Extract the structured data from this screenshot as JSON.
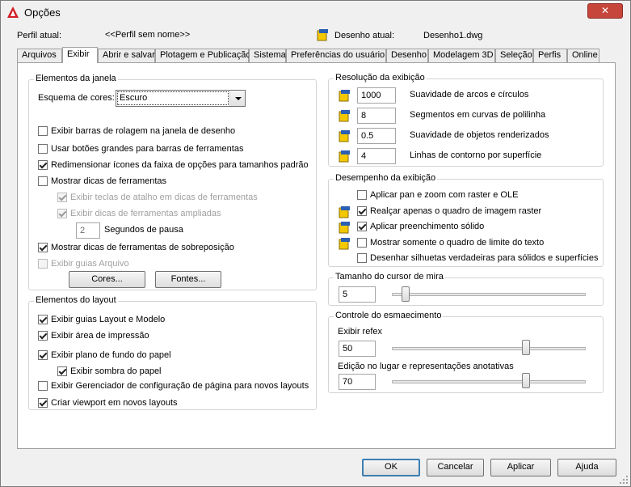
{
  "window": {
    "title": "Opções",
    "close_label": "✕"
  },
  "profile": {
    "current_profile_label": "Perfil atual:",
    "current_profile_value": "<<Perfil sem nome>>",
    "current_drawing_label": "Desenho atual:",
    "current_drawing_value": "Desenho1.dwg"
  },
  "tabs": [
    "Arquivos",
    "Exibir",
    "Abrir e salvar",
    "Plotagem e Publicação",
    "Sistema",
    "Preferências do usuário",
    "Desenho",
    "Modelagem 3D",
    "Seleção",
    "Perfis",
    "Online"
  ],
  "active_tab": "Exibir",
  "window_elements": {
    "title": "Elementos da janela",
    "color_scheme_label": "Esquema de cores:",
    "color_scheme_value": "Escuro",
    "options": [
      {
        "label": "Exibir barras de rolagem na janela de desenho",
        "checked": false,
        "enabled": true
      },
      {
        "label": "Usar botões grandes para barras de ferramentas",
        "checked": false,
        "enabled": true
      },
      {
        "label": "Redimensionar ícones da faixa de opções para tamanhos padrão",
        "checked": true,
        "enabled": true
      },
      {
        "label": "Mostrar dicas de ferramentas",
        "checked": false,
        "enabled": true
      },
      {
        "label": "Exibir teclas de atalho em dicas de ferramentas",
        "checked": true,
        "enabled": false
      },
      {
        "label": "Exibir dicas de ferramentas ampliadas",
        "checked": true,
        "enabled": false
      },
      {
        "label": "Mostrar dicas de ferramentas de sobreposição",
        "checked": true,
        "enabled": true
      },
      {
        "label": "Exibir guias Arquivo",
        "checked": false,
        "enabled": false
      }
    ],
    "delay_value": "2",
    "delay_label": "Segundos de pausa",
    "colors_button": "Cores...",
    "fonts_button": "Fontes..."
  },
  "layout_elements": {
    "title": "Elementos do layout",
    "options": [
      {
        "label": "Exibir guias Layout e Modelo",
        "checked": true
      },
      {
        "label": "Exibir área de impressão",
        "checked": true
      },
      {
        "label": "Exibir plano de fundo do papel",
        "checked": true
      },
      {
        "label": "Exibir sombra do papel",
        "checked": true
      },
      {
        "label": "Exibir Gerenciador de configuração de página para novos layouts",
        "checked": false
      },
      {
        "label": "Criar viewport em novos layouts",
        "checked": true
      }
    ]
  },
  "resolution": {
    "title": "Resolução da exibição",
    "rows": [
      {
        "value": "1000",
        "label": "Suavidade de arcos e círculos"
      },
      {
        "value": "8",
        "label": "Segmentos em curvas de polilinha"
      },
      {
        "value": "0.5",
        "label": "Suavidade de objetos renderizados"
      },
      {
        "value": "4",
        "label": "Linhas de contorno por superfície"
      }
    ]
  },
  "performance": {
    "title": "Desempenho da exibição",
    "options": [
      {
        "label": "Aplicar pan e zoom com raster e OLE",
        "checked": false,
        "icon": false
      },
      {
        "label": "Realçar apenas o quadro de imagem raster",
        "checked": true,
        "icon": true
      },
      {
        "label": "Aplicar preenchimento sólido",
        "checked": true,
        "icon": true
      },
      {
        "label": "Mostrar somente o quadro de limite do texto",
        "checked": false,
        "icon": true
      },
      {
        "label": "Desenhar silhuetas verdadeiras para sólidos e superfícies",
        "checked": false,
        "icon": false
      }
    ]
  },
  "crosshair": {
    "title": "Tamanho do cursor de mira",
    "value": "5",
    "level_fraction": 0.05
  },
  "fade": {
    "title": "Controle do esmaecimento",
    "xref_label": "Exibir refex",
    "xref_value": "50",
    "xref_fraction": 0.7,
    "inplace_label": "Edição no lugar e representações anotativas",
    "inplace_value": "70",
    "inplace_fraction": 0.7
  },
  "footer": {
    "ok": "OK",
    "cancel": "Cancelar",
    "apply": "Aplicar",
    "help": "Ajuda"
  },
  "colors": {
    "accent": "#3c7fb1",
    "close": "#c7463b",
    "app_red": "#d21f26"
  }
}
